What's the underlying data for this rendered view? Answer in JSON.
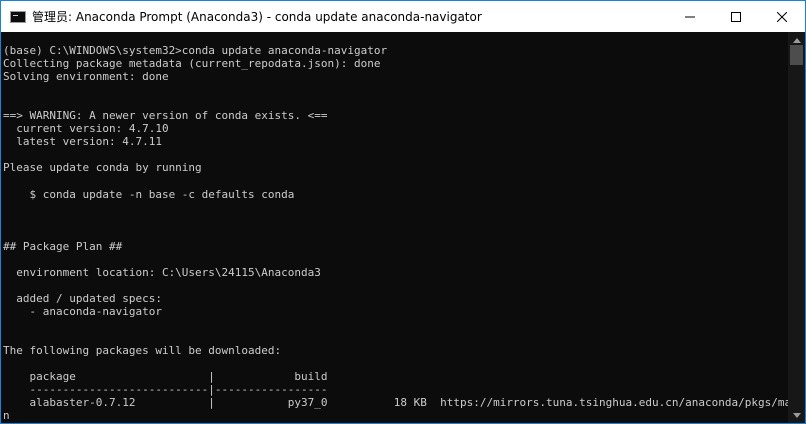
{
  "window": {
    "title": "管理员: Anaconda Prompt (Anaconda3) - conda  update anaconda-navigator",
    "icon": "console-icon"
  },
  "controls": {
    "minimize": "minimize-icon",
    "maximize": "maximize-icon",
    "close": "close-icon"
  },
  "console": {
    "lines": [
      "(base) C:\\WINDOWS\\system32>conda update anaconda-navigator",
      "Collecting package metadata (current_repodata.json): done",
      "Solving environment: done",
      "",
      "",
      "==> WARNING: A newer version of conda exists. <==",
      "  current version: 4.7.10",
      "  latest version: 4.7.11",
      "",
      "Please update conda by running",
      "",
      "    $ conda update -n base -c defaults conda",
      "",
      "",
      "",
      "## Package Plan ##",
      "",
      "  environment location: C:\\Users\\24115\\Anaconda3",
      "",
      "  added / updated specs:",
      "    - anaconda-navigator",
      "",
      "",
      "The following packages will be downloaded:",
      "",
      "    package                    |            build",
      "    ---------------------------|-----------------",
      "    alabaster-0.7.12           |           py37_0          18 KB  https://mirrors.tuna.tsinghua.edu.cn/anaconda/pkgs/mai",
      "n"
    ]
  },
  "scrollbar": {
    "up_arrow": "chevron-up-icon",
    "down_arrow": "chevron-down-icon"
  }
}
